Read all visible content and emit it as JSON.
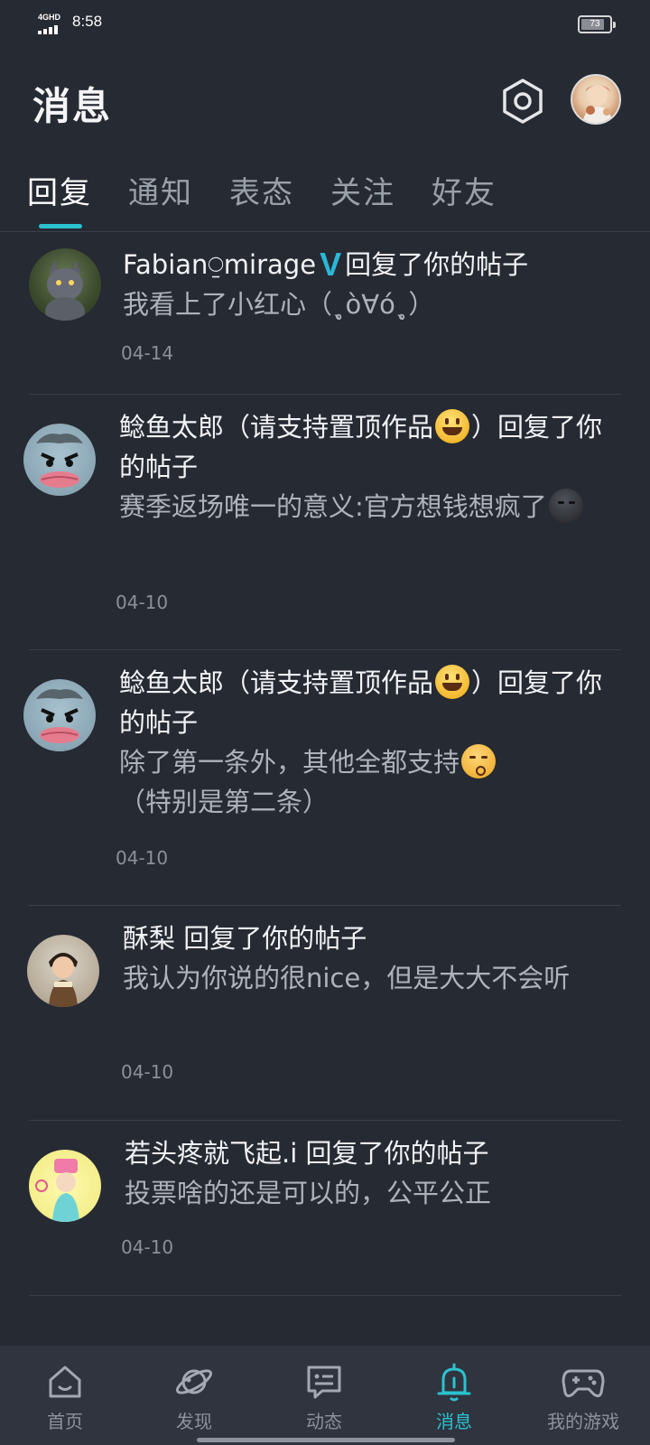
{
  "status_bar": {
    "network": "4GHD",
    "time": "8:58",
    "battery": "73"
  },
  "header": {
    "title": "消息",
    "settings_icon": "hexagon-gear-icon",
    "avatar_icon": "profile-avatar"
  },
  "tabs": [
    {
      "label": "回复",
      "active": true
    },
    {
      "label": "通知",
      "active": false
    },
    {
      "label": "表态",
      "active": false
    },
    {
      "label": "关注",
      "active": false
    },
    {
      "label": "好友",
      "active": false
    }
  ],
  "colors": {
    "background": "#262a33",
    "accent": "#2ac2cf",
    "nav_background": "#2f343f",
    "verified": "#2ab7d8"
  },
  "messages": [
    {
      "user": "Fabian⍜mirage",
      "verified_badge": "V",
      "action": "回复了你的帖子",
      "text": "我看上了小红心（ˎ̥ò∀óˎ̥）",
      "date": "04-14"
    },
    {
      "user": "鲶鱼太郎（请支持置顶作品",
      "user_suffix": "）回复了你的帖子",
      "user_emoji": "grinning-emoji",
      "text": "赛季返场唯一的意义:官方想钱想疯了",
      "text_emoji": "dark-face-emoji",
      "date": "04-10"
    },
    {
      "user": "鲶鱼太郎（请支持置顶作品",
      "user_suffix": "）回复了你的帖子",
      "user_emoji": "grinning-emoji",
      "text": "除了第一条外，其他全都支持",
      "text_emoji": "kissing-emoji",
      "text_line2": "（特别是第二条）",
      "date": "04-10"
    },
    {
      "user": "酥梨",
      "action": "回复了你的帖子",
      "text": "我认为你说的很nice，但是大大不会听",
      "date": "04-10"
    },
    {
      "user": "若头疼就飞起.i",
      "action": "回复了你的帖子",
      "text": "投票啥的还是可以的，公平公正",
      "date": "04-10"
    }
  ],
  "bottom_nav": [
    {
      "label": "首页",
      "icon": "home-icon",
      "active": false
    },
    {
      "label": "发现",
      "icon": "planet-icon",
      "active": false
    },
    {
      "label": "动态",
      "icon": "chat-card-icon",
      "active": false
    },
    {
      "label": "消息",
      "icon": "bell-icon",
      "active": true
    },
    {
      "label": "我的游戏",
      "icon": "gamepad-icon",
      "active": false
    }
  ]
}
